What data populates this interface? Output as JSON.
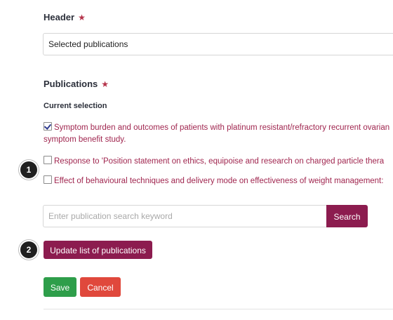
{
  "header_field": {
    "label": "Header",
    "required_marker": "★",
    "value": "Selected publications"
  },
  "publications": {
    "label": "Publications",
    "required_marker": "★",
    "current_selection_label": "Current selection",
    "items": [
      {
        "checked": true,
        "text": "Symptom burden and outcomes of patients with platinum resistant/refractory recurrent ovarian",
        "continuation": "symptom benefit study."
      },
      {
        "checked": false,
        "text": "Response to 'Position statement on ethics, equipoise and research on charged particle thera"
      },
      {
        "checked": false,
        "text": "Effect of behavioural techniques and delivery mode on effectiveness of weight management:"
      }
    ]
  },
  "search": {
    "placeholder": "Enter publication search keyword",
    "value": "",
    "button_label": "Search"
  },
  "update_button_label": "Update list of publications",
  "actions": {
    "save_label": "Save",
    "cancel_label": "Cancel"
  },
  "callouts": [
    "1",
    "2"
  ],
  "colors": {
    "primary": "#8c1c4f",
    "link_text": "#a0264f",
    "required_star": "#b5334a",
    "save": "#2e9e4a",
    "cancel": "#e0483c"
  }
}
